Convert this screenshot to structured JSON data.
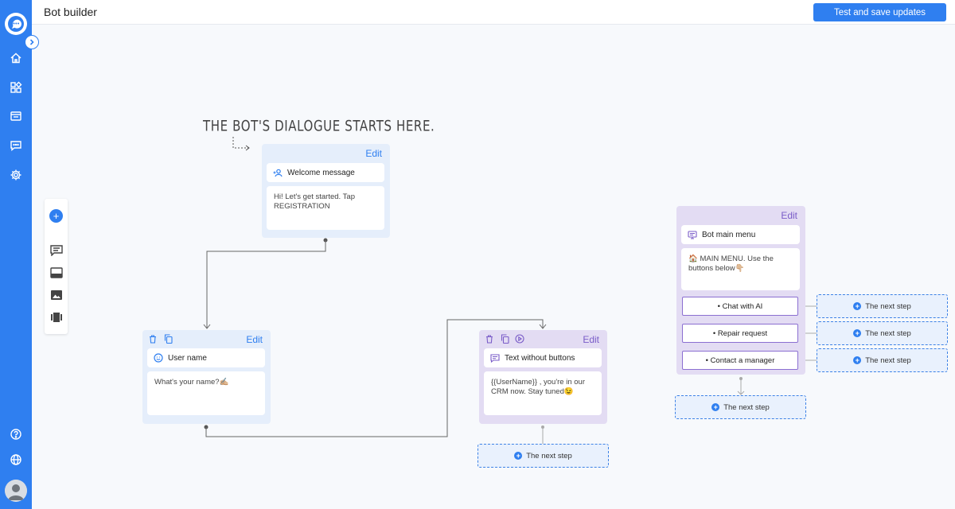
{
  "header": {
    "title": "Bot builder",
    "save_label": "Test and save updates"
  },
  "canvas": {
    "hint": "THE BOT'S DIALOGUE STARTS HERE."
  },
  "nodes": {
    "welcome": {
      "edit": "Edit",
      "title": "Welcome message",
      "message": "Hi! Let's get started. Tap REGISTRATION"
    },
    "user_name": {
      "edit": "Edit",
      "title": "User name",
      "message": "What's your name?✍🏼"
    },
    "text_no_buttons": {
      "edit": "Edit",
      "title": "Text without buttons",
      "message": "{{UserName}} , you're in our CRM now. Stay tuned😉",
      "next_step": "The next step"
    },
    "main_menu": {
      "edit": "Edit",
      "title": "Bot main menu",
      "message": "🏠 MAIN MENU. Use the buttons below👇🏼",
      "buttons": [
        {
          "label": "• Chat with AI",
          "next_step": "The next step"
        },
        {
          "label": "• Repair request",
          "next_step": "The next step"
        },
        {
          "label": "• Contact a manager",
          "next_step": "The next step"
        }
      ],
      "next_step": "The next step"
    }
  },
  "icons": {
    "colors": {
      "primary": "#2f7ff0",
      "purple": "#7a5cc8"
    }
  }
}
